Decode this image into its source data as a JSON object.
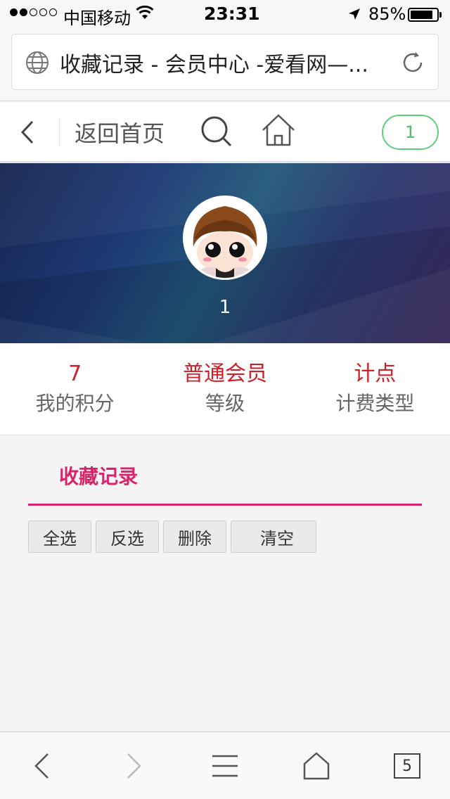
{
  "status_bar": {
    "carrier": "中国移动",
    "time": "23:31",
    "battery": "85%",
    "battery_level": 0.85
  },
  "browser": {
    "url_title": "收藏记录 - 会员中心 -爱看网—..."
  },
  "nav": {
    "home_label": "返回首页",
    "user_badge": "1"
  },
  "profile": {
    "username": "1"
  },
  "stats": [
    {
      "value": "7",
      "label": "我的积分"
    },
    {
      "value": "普通会员",
      "label": "等级"
    },
    {
      "value": "计点",
      "label": "计费类型"
    }
  ],
  "favorites": {
    "tab_title": "收藏记录",
    "actions": [
      "全选",
      "反选",
      "删除",
      "清空"
    ]
  },
  "toolbar": {
    "tab_count": "5"
  },
  "colors": {
    "accent_pink": "#d8246a",
    "stat_red": "#d11f2a",
    "badge_green": "#5fd07a"
  }
}
